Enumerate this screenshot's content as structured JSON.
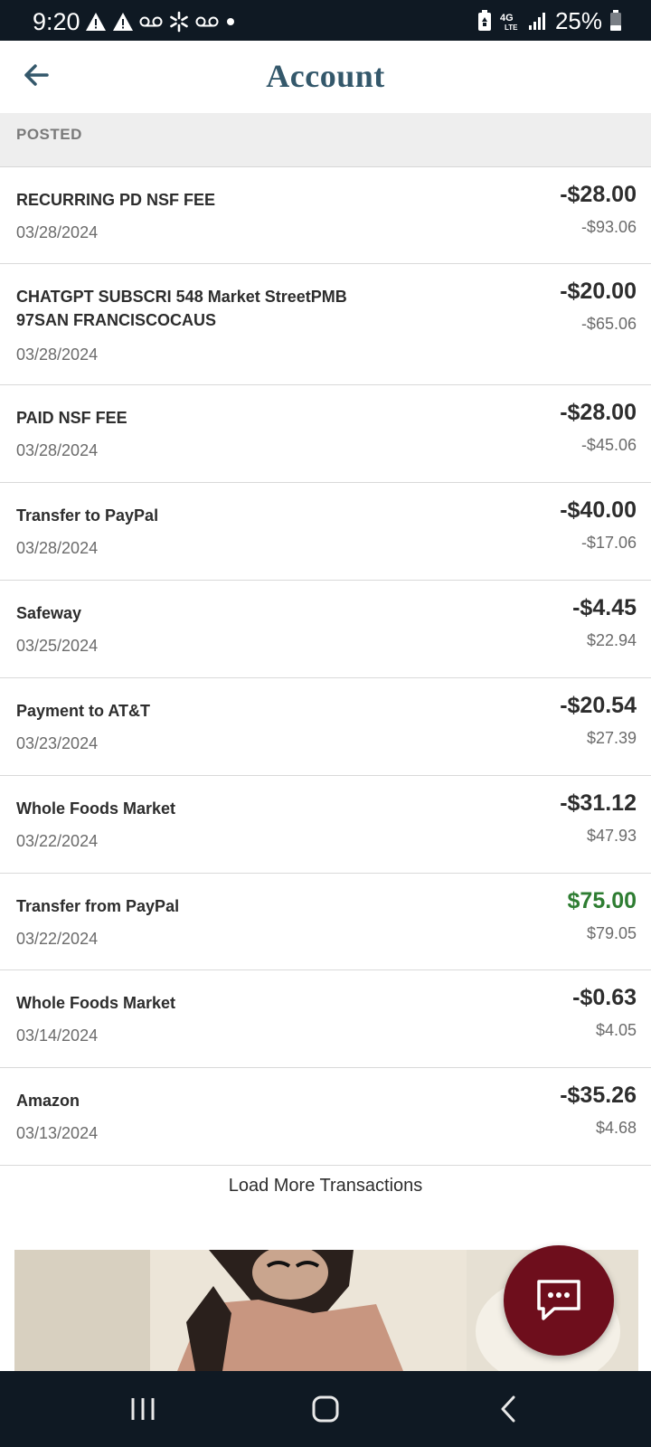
{
  "status_bar": {
    "time": "9:20",
    "battery": "25%",
    "icons_left": [
      "warning-icon",
      "warning-icon",
      "voicemail-icon",
      "walmart-spark-icon",
      "voicemail-icon",
      "dot-icon"
    ],
    "icons_right": [
      "battery-saver-icon",
      "4g-lte-icon",
      "signal-icon",
      "battery-icon"
    ]
  },
  "header": {
    "title": "Account",
    "back_icon": "arrow-left-icon",
    "title_color": "#34586b"
  },
  "section": {
    "label": "POSTED"
  },
  "transactions": [
    {
      "name": "RECURRING PD NSF FEE",
      "date": "03/28/2024",
      "amount": "-$28.00",
      "balance": "-$93.06"
    },
    {
      "name": "CHATGPT SUBSCRI 548 Market StreetPMB 97SAN FRANCISCOCAUS",
      "date": "03/28/2024",
      "amount": "-$20.00",
      "balance": "-$65.06"
    },
    {
      "name": "PAID NSF FEE",
      "date": "03/28/2024",
      "amount": "-$28.00",
      "balance": "-$45.06"
    },
    {
      "name": "Transfer to PayPal",
      "date": "03/28/2024",
      "amount": "-$40.00",
      "balance": "-$17.06"
    },
    {
      "name": "Safeway",
      "date": "03/25/2024",
      "amount": "-$4.45",
      "balance": "$22.94"
    },
    {
      "name": "Payment to AT&T",
      "date": "03/23/2024",
      "amount": "-$20.54",
      "balance": "$27.39"
    },
    {
      "name": "Whole Foods Market",
      "date": "03/22/2024",
      "amount": "-$31.12",
      "balance": "$47.93"
    },
    {
      "name": "Transfer from PayPal",
      "date": "03/22/2024",
      "amount": "$75.00",
      "balance": "$79.05"
    },
    {
      "name": "Whole Foods Market",
      "date": "03/14/2024",
      "amount": "-$0.63",
      "balance": "$4.05"
    },
    {
      "name": "Amazon",
      "date": "03/13/2024",
      "amount": "-$35.26",
      "balance": "$4.68"
    }
  ],
  "load_more_label": "Load More Transactions",
  "chat_button": {
    "icon": "chat-bubble-icon",
    "color": "#6e0e1c"
  },
  "colors": {
    "positive_amount": "#2e7d32",
    "negative_amount": "#2d2d2d"
  },
  "nav_bar": {
    "recent_icon": "recent-apps-icon",
    "home_icon": "home-icon",
    "back_icon": "back-chevron-icon"
  }
}
